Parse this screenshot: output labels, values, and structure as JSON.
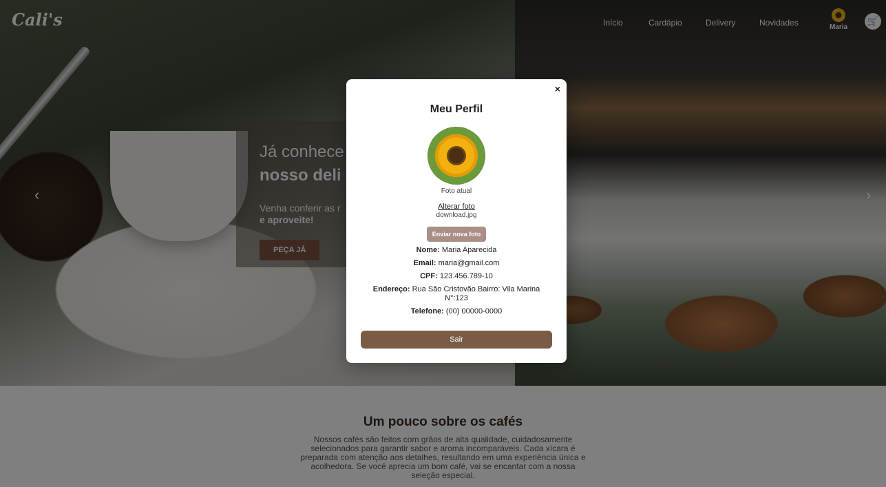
{
  "nav": {
    "logo": "Cali's",
    "links": [
      "Início",
      "Cardápio",
      "Delivery",
      "Novidades"
    ],
    "user_name": "Maria"
  },
  "hero": {
    "title_line1": "Já conhece",
    "title_line2": "nosso deli",
    "subtitle_line1": "Venha conferir as r",
    "subtitle_line2": "e aproveite!",
    "cta": "PEÇA JÁ",
    "prev_arrow": "‹",
    "next_arrow": "›"
  },
  "about": {
    "title": "Um pouco sobre os cafés",
    "text": "Nossos cafés são feitos com grãos de alta qualidade, cuidadosamente selecionados para garantir sabor e aroma incomparáveis. Cada xícara é preparada com atenção aos detalhes, resultando em uma experiência única e acolhedora. Se você aprecia um bom café, vai se encantar com a nossa seleção especial."
  },
  "modal": {
    "close": "×",
    "title": "Meu Perfil",
    "photo_caption": "Foto atual",
    "change_photo": "Alterar foto",
    "filename": "download.jpg",
    "send_button": "Enviar nova foto",
    "fields": {
      "nome_label": "Nome:",
      "nome": "Maria Aparecida",
      "email_label": "Email:",
      "email": "maria@gmail.com",
      "cpf_label": "CPF:",
      "cpf": "123.456.789-10",
      "endereco_label": "Endereço:",
      "endereco": "Rua São Cristovão Bairro: Vila Marina N°:123",
      "telefone_label": "Telefone:",
      "telefone": "(00) 00000-0000"
    },
    "logout": "Sair"
  }
}
